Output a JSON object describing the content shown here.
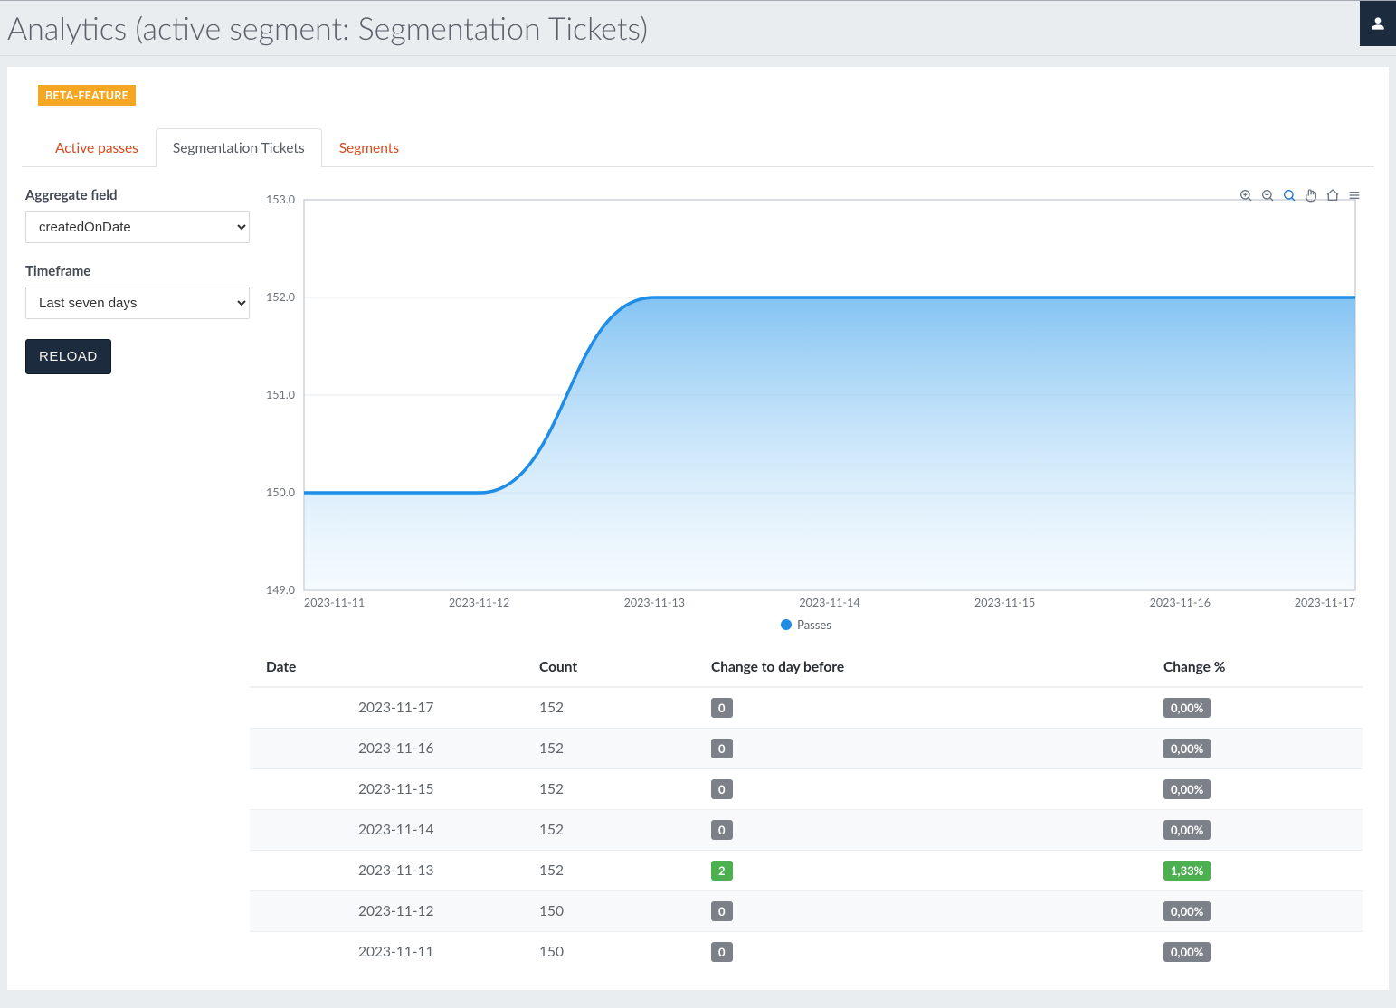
{
  "page": {
    "title": "Analytics (active segment: Segmentation Tickets)"
  },
  "badge": {
    "label": "BETA-FEATURE"
  },
  "tabs": [
    {
      "id": "active-passes",
      "label": "Active passes",
      "active": false
    },
    {
      "id": "segmentation-tickets",
      "label": "Segmentation Tickets",
      "active": true
    },
    {
      "id": "segments",
      "label": "Segments",
      "active": false
    }
  ],
  "form": {
    "aggregate": {
      "label": "Aggregate field",
      "value": "createdOnDate",
      "options": [
        "createdOnDate"
      ]
    },
    "timeframe": {
      "label": "Timeframe",
      "value": "Last seven days",
      "options": [
        "Last seven days"
      ]
    },
    "reload_label": "RELOAD"
  },
  "chart_toolbar": {
    "tools": [
      "zoom-in",
      "zoom-out",
      "selection-zoom",
      "pan",
      "home",
      "menu"
    ],
    "active_tool": "selection-zoom"
  },
  "chart_data": {
    "type": "area",
    "series_name": "Passes",
    "x": [
      "2023-11-11",
      "2023-11-12",
      "2023-11-13",
      "2023-11-14",
      "2023-11-15",
      "2023-11-16",
      "2023-11-17"
    ],
    "y": [
      150,
      150,
      152,
      152,
      152,
      152,
      152
    ],
    "y_ticks": [
      149.0,
      150.0,
      151.0,
      152.0,
      153.0
    ],
    "ylim": [
      149,
      153
    ],
    "legend": "Passes"
  },
  "table": {
    "headers": [
      "Date",
      "Count",
      "Change to day before",
      "Change %"
    ],
    "rows": [
      {
        "date": "2023-11-17",
        "count": 152,
        "change": 0,
        "pct": "0,00%",
        "color": "gray"
      },
      {
        "date": "2023-11-16",
        "count": 152,
        "change": 0,
        "pct": "0,00%",
        "color": "gray"
      },
      {
        "date": "2023-11-15",
        "count": 152,
        "change": 0,
        "pct": "0,00%",
        "color": "gray"
      },
      {
        "date": "2023-11-14",
        "count": 152,
        "change": 0,
        "pct": "0,00%",
        "color": "gray"
      },
      {
        "date": "2023-11-13",
        "count": 152,
        "change": 2,
        "pct": "1,33%",
        "color": "green"
      },
      {
        "date": "2023-11-12",
        "count": 150,
        "change": 0,
        "pct": "0,00%",
        "color": "gray"
      },
      {
        "date": "2023-11-11",
        "count": 150,
        "change": 0,
        "pct": "0,00%",
        "color": "gray"
      }
    ]
  }
}
